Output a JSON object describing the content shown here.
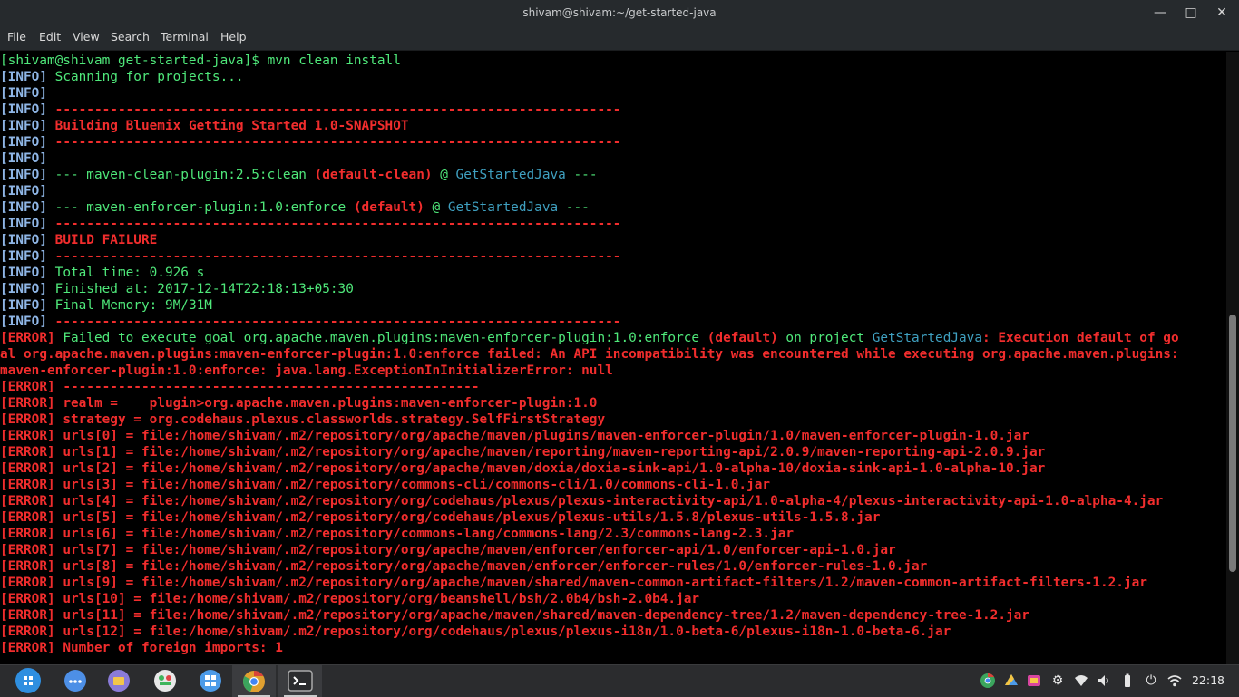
{
  "window": {
    "title": "shivam@shivam:~/get-started-java"
  },
  "window_controls": [
    "—",
    "□",
    "✕"
  ],
  "menu": [
    "File",
    "Edit",
    "View",
    "Search",
    "Terminal",
    "Help"
  ],
  "colors": {
    "tag": "#8fb6e6",
    "green": "#4fe87a",
    "red": "#f12d2d",
    "cyan": "#3fa0c0",
    "white": "#e8e8e8"
  },
  "terminal_lines": [
    [
      [
        "[shivam@shivam get-started-java]$ mvn clean install",
        "green"
      ]
    ],
    [
      [
        "[INFO] ",
        "tag"
      ],
      [
        "Scanning for projects...",
        "green"
      ]
    ],
    [
      [
        "[INFO]",
        "tag"
      ]
    ],
    [
      [
        "[INFO] ",
        "tag"
      ],
      [
        "------------------------------------------------------------------------",
        "red"
      ]
    ],
    [
      [
        "[INFO] ",
        "tag"
      ],
      [
        "Building Bluemix Getting Started 1.0-SNAPSHOT",
        "red"
      ]
    ],
    [
      [
        "[INFO] ",
        "tag"
      ],
      [
        "------------------------------------------------------------------------",
        "red"
      ]
    ],
    [
      [
        "[INFO]",
        "tag"
      ]
    ],
    [
      [
        "[INFO] ",
        "tag"
      ],
      [
        "--- maven-clean-plugin:2.5:clean ",
        "green"
      ],
      [
        "(default-clean)",
        "red"
      ],
      [
        " @ ",
        "green"
      ],
      [
        "GetStartedJava",
        "cyan"
      ],
      [
        " ---",
        "green"
      ]
    ],
    [
      [
        "[INFO]",
        "tag"
      ]
    ],
    [
      [
        "[INFO] ",
        "tag"
      ],
      [
        "--- maven-enforcer-plugin:1.0:enforce ",
        "green"
      ],
      [
        "(default)",
        "red"
      ],
      [
        " @ ",
        "green"
      ],
      [
        "GetStartedJava",
        "cyan"
      ],
      [
        " ---",
        "green"
      ]
    ],
    [
      [
        "[INFO] ",
        "tag"
      ],
      [
        "------------------------------------------------------------------------",
        "red"
      ]
    ],
    [
      [
        "[INFO] ",
        "tag"
      ],
      [
        "BUILD FAILURE",
        "red"
      ]
    ],
    [
      [
        "[INFO] ",
        "tag"
      ],
      [
        "------------------------------------------------------------------------",
        "red"
      ]
    ],
    [
      [
        "[INFO] ",
        "tag"
      ],
      [
        "Total time: 0.926 s",
        "green"
      ]
    ],
    [
      [
        "[INFO] ",
        "tag"
      ],
      [
        "Finished at: 2017-12-14T22:18:13+05:30",
        "green"
      ]
    ],
    [
      [
        "[INFO] ",
        "tag"
      ],
      [
        "Final Memory: 9M/31M",
        "green"
      ]
    ],
    [
      [
        "[INFO] ",
        "tag"
      ],
      [
        "------------------------------------------------------------------------",
        "red"
      ]
    ],
    [
      [
        "[ERROR] ",
        "red"
      ],
      [
        "Failed to execute goal org.apache.maven.plugins:maven-enforcer-plugin:1.0:enforce ",
        "green"
      ],
      [
        "(default)",
        "red"
      ],
      [
        " on project ",
        "green"
      ],
      [
        "GetStartedJava",
        "cyan"
      ],
      [
        ": Execution default of go",
        "red"
      ]
    ],
    [
      [
        "al org.apache.maven.plugins:maven-enforcer-plugin:1.0:enforce failed: An API incompatibility was encountered while executing org.apache.maven.plugins:",
        "red"
      ]
    ],
    [
      [
        "maven-enforcer-plugin:1.0:enforce: java.lang.ExceptionInInitializerError: null",
        "red"
      ]
    ],
    [
      [
        "[ERROR] ",
        "red"
      ],
      [
        "-----------------------------------------------------",
        "red"
      ]
    ],
    [
      [
        "[ERROR] ",
        "red"
      ],
      [
        "realm =    plugin>org.apache.maven.plugins:maven-enforcer-plugin:1.0",
        "red"
      ]
    ],
    [
      [
        "[ERROR] ",
        "red"
      ],
      [
        "strategy = org.codehaus.plexus.classworlds.strategy.SelfFirstStrategy",
        "red"
      ]
    ],
    [
      [
        "[ERROR] ",
        "red"
      ],
      [
        "urls[0] = file:/home/shivam/.m2/repository/org/apache/maven/plugins/maven-enforcer-plugin/1.0/maven-enforcer-plugin-1.0.jar",
        "red"
      ]
    ],
    [
      [
        "[ERROR] ",
        "red"
      ],
      [
        "urls[1] = file:/home/shivam/.m2/repository/org/apache/maven/reporting/maven-reporting-api/2.0.9/maven-reporting-api-2.0.9.jar",
        "red"
      ]
    ],
    [
      [
        "[ERROR] ",
        "red"
      ],
      [
        "urls[2] = file:/home/shivam/.m2/repository/org/apache/maven/doxia/doxia-sink-api/1.0-alpha-10/doxia-sink-api-1.0-alpha-10.jar",
        "red"
      ]
    ],
    [
      [
        "[ERROR] ",
        "red"
      ],
      [
        "urls[3] = file:/home/shivam/.m2/repository/commons-cli/commons-cli/1.0/commons-cli-1.0.jar",
        "red"
      ]
    ],
    [
      [
        "[ERROR] ",
        "red"
      ],
      [
        "urls[4] = file:/home/shivam/.m2/repository/org/codehaus/plexus/plexus-interactivity-api/1.0-alpha-4/plexus-interactivity-api-1.0-alpha-4.jar",
        "red"
      ]
    ],
    [
      [
        "[ERROR] ",
        "red"
      ],
      [
        "urls[5] = file:/home/shivam/.m2/repository/org/codehaus/plexus/plexus-utils/1.5.8/plexus-utils-1.5.8.jar",
        "red"
      ]
    ],
    [
      [
        "[ERROR] ",
        "red"
      ],
      [
        "urls[6] = file:/home/shivam/.m2/repository/commons-lang/commons-lang/2.3/commons-lang-2.3.jar",
        "red"
      ]
    ],
    [
      [
        "[ERROR] ",
        "red"
      ],
      [
        "urls[7] = file:/home/shivam/.m2/repository/org/apache/maven/enforcer/enforcer-api/1.0/enforcer-api-1.0.jar",
        "red"
      ]
    ],
    [
      [
        "[ERROR] ",
        "red"
      ],
      [
        "urls[8] = file:/home/shivam/.m2/repository/org/apache/maven/enforcer/enforcer-rules/1.0/enforcer-rules-1.0.jar",
        "red"
      ]
    ],
    [
      [
        "[ERROR] ",
        "red"
      ],
      [
        "urls[9] = file:/home/shivam/.m2/repository/org/apache/maven/shared/maven-common-artifact-filters/1.2/maven-common-artifact-filters-1.2.jar",
        "red"
      ]
    ],
    [
      [
        "[ERROR] ",
        "red"
      ],
      [
        "urls[10] = file:/home/shivam/.m2/repository/org/beanshell/bsh/2.0b4/bsh-2.0b4.jar",
        "red"
      ]
    ],
    [
      [
        "[ERROR] ",
        "red"
      ],
      [
        "urls[11] = file:/home/shivam/.m2/repository/org/apache/maven/shared/maven-dependency-tree/1.2/maven-dependency-tree-1.2.jar",
        "red"
      ]
    ],
    [
      [
        "[ERROR] ",
        "red"
      ],
      [
        "urls[12] = file:/home/shivam/.m2/repository/org/codehaus/plexus/plexus-i18n/1.0-beta-6/plexus-i18n-1.0-beta-6.jar",
        "red"
      ]
    ],
    [
      [
        "[ERROR] ",
        "red"
      ],
      [
        "Number of foreign imports: 1",
        "red"
      ]
    ]
  ],
  "taskbar": {
    "apps": [
      {
        "icon": "launcher-icon",
        "color": "#2f8fe0"
      },
      {
        "icon": "dots-menu-icon",
        "color": "#4d8fe6"
      },
      {
        "icon": "files-icon",
        "color": "#8a7bd8"
      },
      {
        "icon": "tasks-icon",
        "color": "#e8e8e8"
      },
      {
        "icon": "apps-grid-icon",
        "color": "#4c9be8"
      },
      {
        "icon": "chrome-icon",
        "color": "#e0a030"
      },
      {
        "icon": "terminal-icon",
        "color": "#2b2c2e"
      }
    ],
    "tray": [
      "chrome-tray-icon",
      "drive-tray-icon",
      "store-tray-icon",
      "gear-icon",
      "wifi-icon",
      "volume-icon",
      "battery-icon",
      "power-icon",
      "network-icon"
    ],
    "clock": "22:18"
  }
}
